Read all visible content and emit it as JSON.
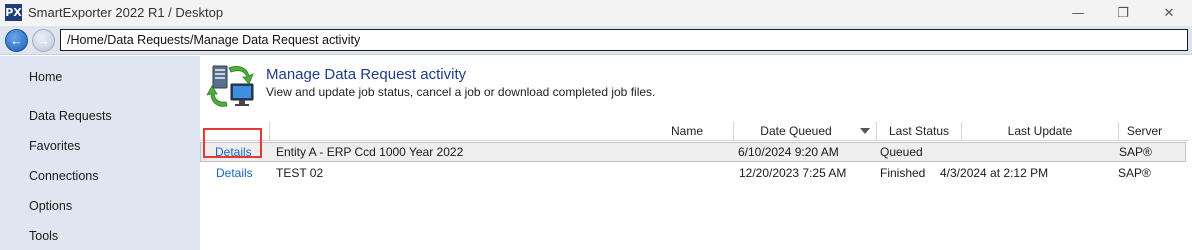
{
  "window": {
    "logo_text": "PX",
    "title": "SmartExporter 2022 R1 / Desktop",
    "minimize_glyph": "—",
    "maximize_glyph": "❐",
    "close_glyph": "✕"
  },
  "nav": {
    "back_glyph": "←",
    "forward_glyph": "→",
    "address": "/Home/Data Requests/Manage Data Request activity"
  },
  "sidebar": {
    "items": [
      {
        "label": "Home"
      },
      {
        "label": "Data Requests"
      },
      {
        "label": "Favorites"
      },
      {
        "label": "Connections"
      },
      {
        "label": "Options"
      },
      {
        "label": "Tools"
      }
    ]
  },
  "main": {
    "title": "Manage Data Request activity",
    "subtitle": "View and update job status, cancel a job or download completed job files."
  },
  "grid": {
    "columns": [
      {
        "label": ""
      },
      {
        "label": "Name"
      },
      {
        "label": "Date Queued"
      },
      {
        "label": "Last Status"
      },
      {
        "label": "Last Update"
      },
      {
        "label": "Server"
      }
    ],
    "sorted_column": "Date Queued",
    "sort_direction": "descending",
    "rows": [
      {
        "action": "Details",
        "name": "Entity A - ERP Ccd 1000 Year 2022",
        "date_queued": "6/10/2024 9:20 AM",
        "last_status": "Queued",
        "last_update": "",
        "server": "SAP®",
        "selected": true
      },
      {
        "action": "Details",
        "name": "TEST 02",
        "date_queued": "12/20/2023 7:25 AM",
        "last_status": "Finished",
        "last_update": "4/3/2024 at 2:12 PM",
        "server": "SAP®",
        "selected": false
      }
    ]
  },
  "colors": {
    "accent": "#1d3d8f",
    "link": "#1a64c8",
    "sidebar_bg": "#dfe6f1",
    "highlight": "#e53935"
  }
}
